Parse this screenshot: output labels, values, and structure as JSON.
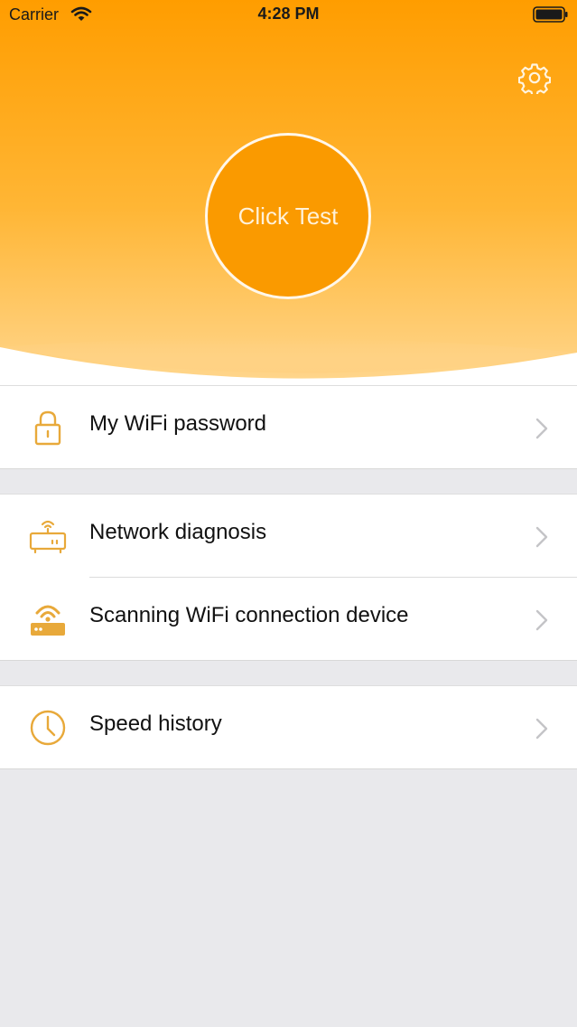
{
  "status_bar": {
    "carrier": "Carrier",
    "time": "4:28 PM"
  },
  "header": {
    "test_button_label": "Click Test",
    "accent_color": "#fa9a00",
    "gradient_top": "#ff9d00",
    "gradient_bottom": "#ffd58a"
  },
  "menu": {
    "wifi_password": "My WiFi password",
    "network_diagnosis": "Network diagnosis",
    "scanning_devices": "Scanning WiFi connection device",
    "speed_history": "Speed history"
  },
  "icons": {
    "settings": "gear-icon",
    "wifi_password": "lock-icon",
    "network_diagnosis": "router-icon",
    "scanning_devices": "router-signal-icon",
    "speed_history": "clock-icon",
    "chevron": "chevron-right-icon"
  },
  "colors": {
    "icon": "#e8a93a",
    "chevron": "#c4c4c7",
    "background": "#e9e9ec"
  }
}
